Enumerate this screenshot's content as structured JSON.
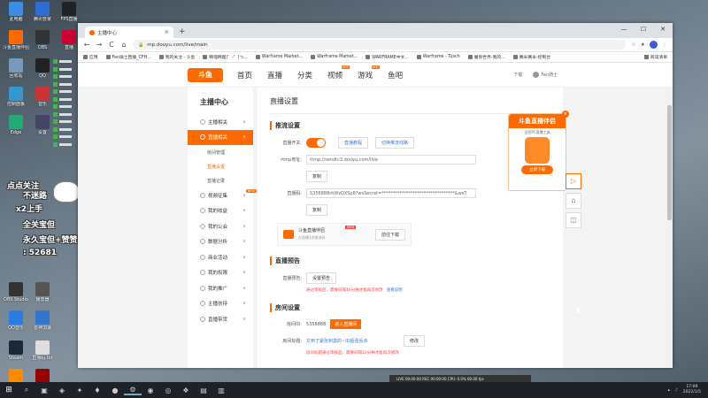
{
  "desktop": {
    "icons": [
      {
        "label": "此电脑",
        "color": "#3a8ee6"
      },
      {
        "label": "腾讯管家",
        "color": "#2b6fd6"
      },
      {
        "label": "FPS直播",
        "color": "#222"
      },
      {
        "label": "斗鱼直播伴侣",
        "color": "#ff6a00"
      },
      {
        "label": "OBS",
        "color": "#333"
      },
      {
        "label": "直播",
        "color": "#c03"
      },
      {
        "label": "回收站",
        "color": "#79b"
      },
      {
        "label": "QQ",
        "color": "#222"
      },
      {
        "label": "控制面板",
        "color": "#39c"
      },
      {
        "label": "音乐",
        "color": "#c33"
      },
      {
        "label": "Edge",
        "color": "#2a7"
      },
      {
        "label": "设置",
        "color": "#446"
      }
    ],
    "bottom_icons": [
      {
        "label": "OBS Studio"
      },
      {
        "label": "播放器"
      },
      {
        "label": "QQ音乐"
      },
      {
        "label": "雷神加速"
      },
      {
        "label": "Steam"
      },
      {
        "label": "直播码.txt"
      },
      {
        "label": "WeGame"
      },
      {
        "label": "ArmouryC..."
      }
    ],
    "overlay": {
      "line1": "点点关注",
      "line2": "不迷路",
      "line3": "x2上手",
      "line4": "全关宝但",
      "line5": "永久宝但+赞赞",
      "line6": ": 52681"
    }
  },
  "browser": {
    "tab_title": "主播中心",
    "tab_close": "×",
    "new_tab": "+",
    "window_controls": [
      "—",
      "☐",
      "✕"
    ],
    "nav": [
      "←",
      "→",
      "C",
      "⌂"
    ],
    "url": "mp.douyu.com/live/main",
    "addr_right": [
      "☆",
      "★",
      "⋮"
    ],
    "bookmarks": [
      "应用",
      "Fan骑士直播_CFH...",
      "我的关注 - 斗鱼",
      "韩哩韩哩(゜-゜)つ...",
      "Warframe Market...",
      "Warframe Market...",
      "WARFRAME中文...",
      "Warframe - Tusch",
      "魔兽世界-我的...",
      "赛米赛米-控制台"
    ],
    "reading_list": "阅读清单"
  },
  "douyu": {
    "logo": "斗鱼",
    "nav": [
      "首页",
      "直播",
      "分类",
      "视频",
      "游戏",
      "鱼吧"
    ],
    "nav_hot": "HOT",
    "download": "下载",
    "username": "Fan骑士",
    "sidebar_title": "主播中心",
    "sidebar": [
      {
        "label": "主播相关",
        "active": false
      },
      {
        "label": "直播相关",
        "active": true
      },
      {
        "label": "视频征集",
        "active": false,
        "badge": "NEW"
      },
      {
        "label": "我的收益",
        "active": false
      },
      {
        "label": "我的公会",
        "active": false
      },
      {
        "label": "数据分析",
        "active": false
      },
      {
        "label": "商业活动",
        "active": false
      },
      {
        "label": "我的权限",
        "active": false
      },
      {
        "label": "我的推广",
        "active": false
      },
      {
        "label": "主播扶持",
        "active": false
      },
      {
        "label": "直播带货",
        "active": false
      }
    ],
    "sub_items": [
      "房间管理",
      "直播设置",
      "直播记录"
    ],
    "main_title": "直播设置",
    "push": {
      "title": "推流设置",
      "switch_label": "直播开关:",
      "btn_tutorial": "直播教程",
      "btn_switch": "切换推流线路",
      "rtmp_label": "rtmp地址:",
      "rtmp_value": "rtmp://sendtc3.douyu.com/live",
      "copy": "复制",
      "code_label": "直播码:",
      "code_value": "5356888rhWzDXSp8?wsSecret=*********************************&wsT",
      "copy2": "复制"
    },
    "promo": {
      "title": "斗鱼直播伴侣",
      "sub": "仅直播1次推流码",
      "new": "NEW",
      "download": "前往下载"
    },
    "preview": {
      "title": "直播预告",
      "label": "直播预告:",
      "btn": "设置预告",
      "hint": "通过审核后，需要间隔10分钟才能再次修改",
      "link": "查看说明"
    },
    "room": {
      "title": "房间设置",
      "id_label": "房间ID:",
      "id_value": "5356888",
      "enter": "进入直播间",
      "title_label": "房间标题:",
      "title_value": "又到了紧张刺激的~ID超强反杀",
      "edit": "修改",
      "hint": "房间标题通过审核后，需要间隔10分钟才能再次修改"
    },
    "widget": {
      "title": "斗鱼直播伴侣",
      "sub": "全民PC直播工具",
      "btn": "立即下载",
      "close": "×"
    }
  },
  "taskbar": {
    "start": "⊞",
    "icons": [
      "⌕",
      "▣",
      "◈",
      "✦",
      "♦",
      "●",
      "⚙",
      "◉",
      "◎",
      "❖",
      "▤",
      "▥"
    ],
    "stats": "LIVE   00:00:00   REC  00:00:00   CPU: 0.0%   60.00 fps",
    "time": "17:09",
    "date": "2022/1/5"
  }
}
